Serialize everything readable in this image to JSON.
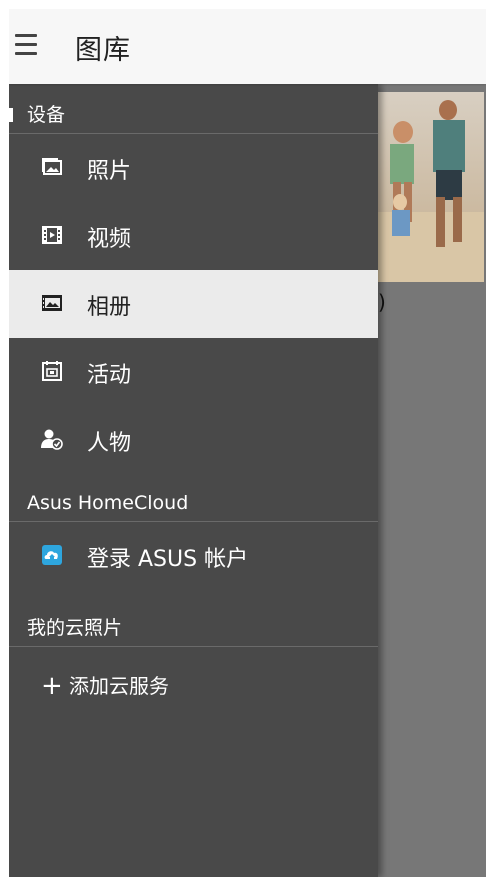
{
  "appbar": {
    "title": "图库",
    "menu_icon": "hamburger-menu-icon"
  },
  "background": {
    "thumbnail_label": ")"
  },
  "drawer": {
    "device_section": {
      "header": "设备",
      "items": [
        {
          "label": "照片",
          "icon": "photo-icon",
          "selected": false
        },
        {
          "label": "视频",
          "icon": "film-icon",
          "selected": false
        },
        {
          "label": "相册",
          "icon": "album-icon",
          "selected": true
        },
        {
          "label": "活动",
          "icon": "calendar-icon",
          "selected": false
        },
        {
          "label": "人物",
          "icon": "person-icon",
          "selected": false
        }
      ]
    },
    "cloud_section": {
      "header": "Asus HomeCloud",
      "items": [
        {
          "label": "登录 ASUS 帐户",
          "icon": "homecloud-icon"
        }
      ]
    },
    "my_cloud_section": {
      "header": "我的云照片",
      "add_label": "添加云服务",
      "add_icon": "plus-icon"
    }
  },
  "colors": {
    "drawer_bg": "#494949",
    "selected_bg": "#ebebeb",
    "appbar_bg": "#f7f7f7",
    "cloud_icon": "#2ea6de"
  }
}
